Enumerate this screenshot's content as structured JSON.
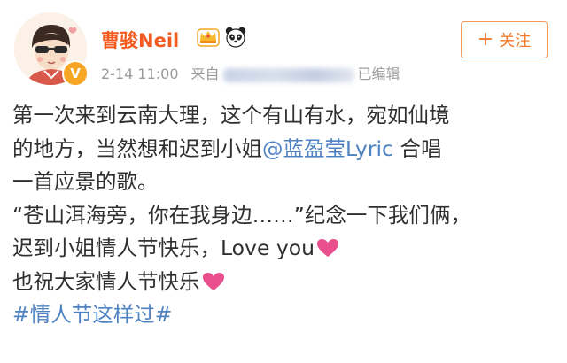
{
  "user": {
    "name": "曹骏Neil",
    "badges": [
      "crown-icon",
      "panda-icon"
    ],
    "verified": true
  },
  "meta": {
    "time": "2-14 11:00",
    "source_prefix": "来自",
    "edited_suffix": "已编辑"
  },
  "follow_button": {
    "icon": "+",
    "label": "关注"
  },
  "post": {
    "line1": "第一次来到云南大理，这个有山有水，宛如仙境",
    "line2_before": "的地方，当然想和迟到小姐",
    "mention": "@蓝盈莹Lyric",
    "line2_after": " 合唱",
    "line3": "一首应景的歌。",
    "line4": "“苍山洱海旁，你在我身边……”纪念一下我们俩，",
    "line5": "迟到小姐情人节快乐，Love you",
    "line6": "也祝大家情人节快乐",
    "hashtag": "#情人节这样过#"
  },
  "colors": {
    "username": "#f25a1f",
    "link": "#4f82c2",
    "heart": "#e84f8c",
    "follow": "#f07a2c"
  }
}
